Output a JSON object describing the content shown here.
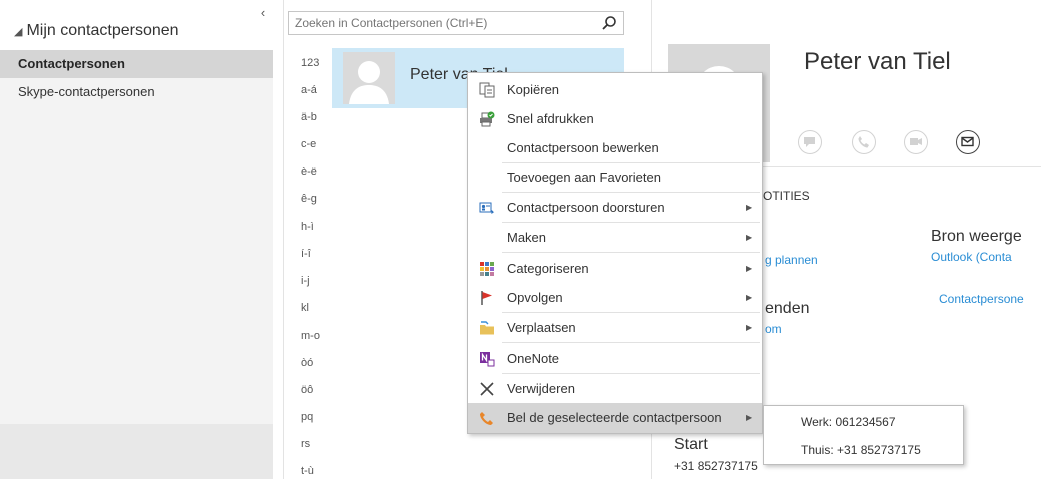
{
  "nav": {
    "collapse_glyph": "‹",
    "header": "Mijn contactpersonen",
    "items": [
      {
        "label": "Contactpersonen"
      },
      {
        "label": "Skype-contactpersonen"
      }
    ]
  },
  "search": {
    "placeholder": "Zoeken in Contactpersonen (Ctrl+E)"
  },
  "index": [
    "123",
    "a-á",
    "ä-b",
    "c-e",
    "è-ë",
    "ê-g",
    "h-ì",
    "í-î",
    "i-j",
    "kl",
    "m-o",
    "òó",
    "öô",
    "pq",
    "rs",
    "t-ù"
  ],
  "card": {
    "name": "Peter van Tiel"
  },
  "detail": {
    "name": "Peter van Tiel",
    "notes_heading": "OTITIES",
    "link1": "g plannen",
    "friends": "enden",
    "friends_link": "om",
    "source_heading": "Bron weerge",
    "source_link": "Outlook (Conta",
    "contacts_link": "Contactpersone",
    "start_label": "Start",
    "start_phone": "+31 852737175"
  },
  "menu": {
    "items": [
      {
        "label": "Kopiëren",
        "icon": "copy-icon"
      },
      {
        "label": "Snel afdrukken",
        "icon": "quick-print-icon"
      },
      {
        "label": "Contactpersoon bewerken",
        "icon": ""
      },
      {
        "label": "Toevoegen aan Favorieten",
        "icon": ""
      },
      {
        "label": "Contactpersoon doorsturen",
        "icon": "forward-contact-icon"
      },
      {
        "label": "Maken",
        "icon": ""
      },
      {
        "label": "Categoriseren",
        "icon": "categorize-icon"
      },
      {
        "label": "Opvolgen",
        "icon": "follow-up-flag-icon"
      },
      {
        "label": "Verplaatsen",
        "icon": "move-folder-icon"
      },
      {
        "label": "OneNote",
        "icon": "onenote-icon"
      },
      {
        "label": "Verwijderen",
        "icon": "delete-icon"
      },
      {
        "label": "Bel de geselecteerde contactpersoon",
        "icon": "phone-icon"
      }
    ]
  },
  "submenu": {
    "items": [
      {
        "label": "Werk: 061234567"
      },
      {
        "label": "Thuis: +31 852737175"
      }
    ]
  },
  "colors": {
    "selection": "#cde8f7",
    "link": "#2a8dd4",
    "nav_selected": "#d5d5d5",
    "menu_highlight": "#d5d5d5"
  }
}
